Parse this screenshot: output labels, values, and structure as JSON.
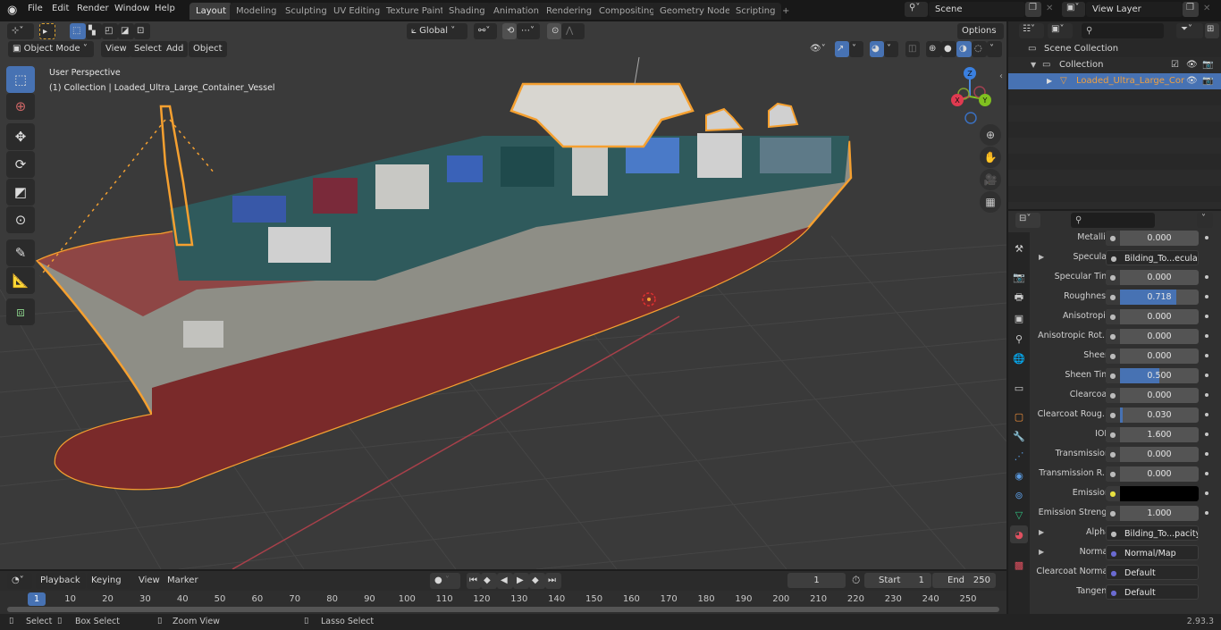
{
  "topbar": {
    "menus": [
      "File",
      "Edit",
      "Render",
      "Window",
      "Help"
    ],
    "workspaces": [
      "Layout",
      "Modeling",
      "Sculpting",
      "UV Editing",
      "Texture Paint",
      "Shading",
      "Animation",
      "Rendering",
      "Compositing",
      "Geometry Nodes",
      "Scripting"
    ],
    "active_workspace": "Layout",
    "add_workspace": "+",
    "scene": "Scene",
    "view_layer": "View Layer"
  },
  "viewport": {
    "mode": "Object Mode",
    "menus": [
      "View",
      "Select",
      "Add",
      "Object"
    ],
    "transform_orientation": "Global",
    "options": "Options",
    "overlay_title": "User Perspective",
    "overlay_subtitle": "(1) Collection | Loaded_Ultra_Large_Container_Vessel",
    "gizmo_axes": {
      "x": "X",
      "y": "Y",
      "z": "Z"
    },
    "colors": {
      "selection_outline": "#f5a030",
      "background": "#3a3a3a",
      "grid": "#454545",
      "x_axis": "#b0404a",
      "hull_red": "#7a2a2a",
      "hull_gray": "#8e8e86"
    }
  },
  "outliner": {
    "scene_collection": "Scene Collection",
    "collection": "Collection",
    "object": "Loaded_Ultra_Large_Cor"
  },
  "properties": {
    "rows": [
      {
        "label": "Metallic",
        "value": "0.000",
        "fill": 0
      },
      {
        "label": "Specular",
        "value": "Bilding_To...ecular.png",
        "link": true,
        "expand": true
      },
      {
        "label": "Specular Tint",
        "value": "0.000",
        "fill": 0
      },
      {
        "label": "Roughness",
        "value": "0.718",
        "fill": 0.718
      },
      {
        "label": "Anisotropic",
        "value": "0.000",
        "fill": 0
      },
      {
        "label": "Anisotropic Rot...",
        "value": "0.000",
        "fill": 0
      },
      {
        "label": "Sheen",
        "value": "0.000",
        "fill": 0
      },
      {
        "label": "Sheen Tint",
        "value": "0.500",
        "fill": 0.5
      },
      {
        "label": "Clearcoat",
        "value": "0.000",
        "fill": 0
      },
      {
        "label": "Clearcoat Roug...",
        "value": "0.030",
        "fill": 0.03
      },
      {
        "label": "IOR",
        "value": "1.600",
        "fill": 0
      },
      {
        "label": "Transmission",
        "value": "0.000",
        "fill": 0
      },
      {
        "label": "Transmission R...",
        "value": "0.000",
        "fill": 0
      },
      {
        "label": "Emission",
        "value": "",
        "color": "#000000"
      },
      {
        "label": "Emission Strengt",
        "value": "1.000",
        "fill": 0
      },
      {
        "label": "Alpha",
        "value": "Bilding_To...pacity.png",
        "link": true,
        "expand": true
      },
      {
        "label": "Normal",
        "value": "Normal/Map",
        "link": true,
        "expand": true,
        "vector": true
      },
      {
        "label": "Clearcoat Normal",
        "value": "Default",
        "link": true,
        "vector": true
      },
      {
        "label": "Tangent",
        "value": "Default",
        "link": true,
        "vector": true
      }
    ]
  },
  "timeline": {
    "menus": [
      "Playback",
      "Keying",
      "View",
      "Marker"
    ],
    "current_frame": "1",
    "start_label": "Start",
    "start": "1",
    "end_label": "End",
    "end": "250",
    "ticks": [
      "10",
      "20",
      "30",
      "40",
      "50",
      "60",
      "70",
      "80",
      "90",
      "100",
      "110",
      "120",
      "130",
      "140",
      "150",
      "160",
      "170",
      "180",
      "190",
      "200",
      "210",
      "220",
      "230",
      "240",
      "250"
    ]
  },
  "statusbar": {
    "select": "Select",
    "box_select": "Box Select",
    "zoom_view": "Zoom View",
    "lasso_select": "Lasso Select",
    "version": "2.93.3"
  }
}
